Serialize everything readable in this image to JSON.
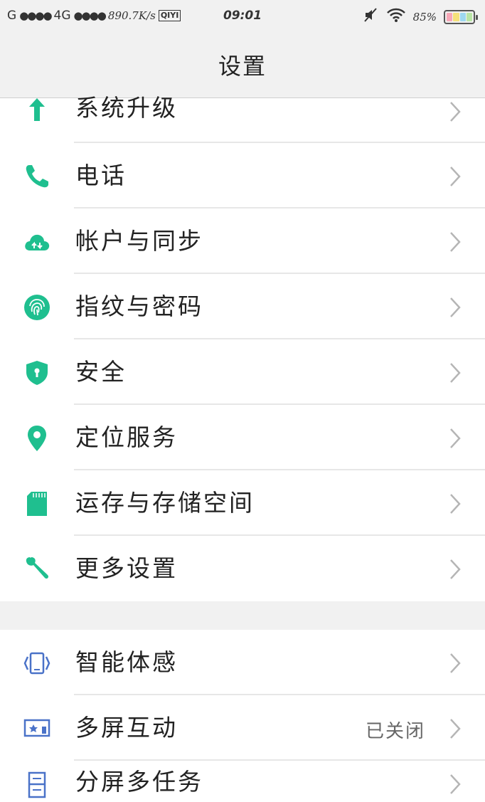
{
  "status_bar": {
    "carrier1": "G",
    "signal1": "●●●●",
    "carrier2": "4G",
    "signal2": "●●●●",
    "speed": "890.7K/s",
    "app_badge": "QIYI",
    "time": "09:01",
    "battery": "85%",
    "battery_colors": [
      "#f7a8b8",
      "#f5e17a",
      "#9ed8f0",
      "#b9e5a5"
    ]
  },
  "header": {
    "title": "设置"
  },
  "group1": [
    {
      "label": "系统升级",
      "icon": "arrow-up-icon"
    },
    {
      "label": "电话",
      "icon": "phone-icon"
    },
    {
      "label": "帐户与同步",
      "icon": "cloud-sync-icon"
    },
    {
      "label": "指纹与密码",
      "icon": "fingerprint-icon"
    },
    {
      "label": "安全",
      "icon": "shield-icon"
    },
    {
      "label": "定位服务",
      "icon": "location-pin-icon"
    },
    {
      "label": "运存与存储空间",
      "icon": "sd-card-icon"
    },
    {
      "label": "更多设置",
      "icon": "wrench-icon"
    }
  ],
  "group2": [
    {
      "label": "智能体感",
      "icon": "motion-sense-icon",
      "value": ""
    },
    {
      "label": "多屏互动",
      "icon": "multi-screen-icon",
      "value": "已关闭"
    },
    {
      "label": "分屏多任务",
      "icon": "split-screen-icon",
      "value": ""
    }
  ],
  "colors": {
    "accent_green": "#1fbf8f",
    "accent_blue": "#4a72c8",
    "chevron": "#b5b5b5"
  }
}
